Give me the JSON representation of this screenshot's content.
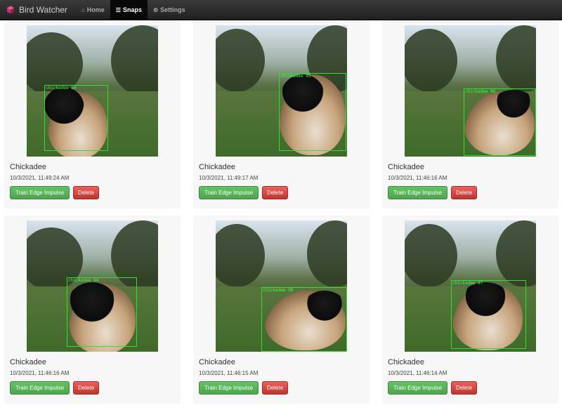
{
  "navbar": {
    "brand": "Bird Watcher",
    "items": [
      {
        "icon": "home-icon",
        "glyph": "⌂",
        "label": "Home",
        "active": false
      },
      {
        "icon": "list-icon",
        "glyph": "☰",
        "label": "Snaps",
        "active": true
      },
      {
        "icon": "gears-icon",
        "glyph": "⚙",
        "label": "Settings",
        "active": false
      }
    ]
  },
  "snaps": [
    {
      "name": "Chickadee",
      "time": "10/3/2021, 11:49:24 AM",
      "detection": "chickadee 89",
      "train": "Train Edge Impulse",
      "delete": "Delete"
    },
    {
      "name": "Chickadee",
      "time": "10/3/2021, 11:49:17 AM",
      "detection": "chickadee 93",
      "train": "Train Edge Impulse",
      "delete": "Delete"
    },
    {
      "name": "Chickadee",
      "time": "10/3/2021, 11:46:16 AM",
      "detection": "chickadee 96",
      "train": "Train Edge Impulse",
      "delete": "Delete"
    },
    {
      "name": "Chickadee",
      "time": "10/3/2021, 11:46:16 AM",
      "detection": "chickadee 94",
      "train": "Train Edge Impulse",
      "delete": "Delete"
    },
    {
      "name": "Chickadee",
      "time": "10/3/2021, 11:46:15 AM",
      "detection": "chickadee 98",
      "train": "Train Edge Impulse",
      "delete": "Delete"
    },
    {
      "name": "Chickadee",
      "time": "10/3/2021, 11:46:14 AM",
      "detection": "chickadee 97",
      "train": "Train Edge Impulse",
      "delete": "Delete"
    }
  ],
  "colors": {
    "navbar": "#222222",
    "train_button": "#5bb75b",
    "delete_button": "#da4f49",
    "detection_box": "#2ee02e"
  }
}
